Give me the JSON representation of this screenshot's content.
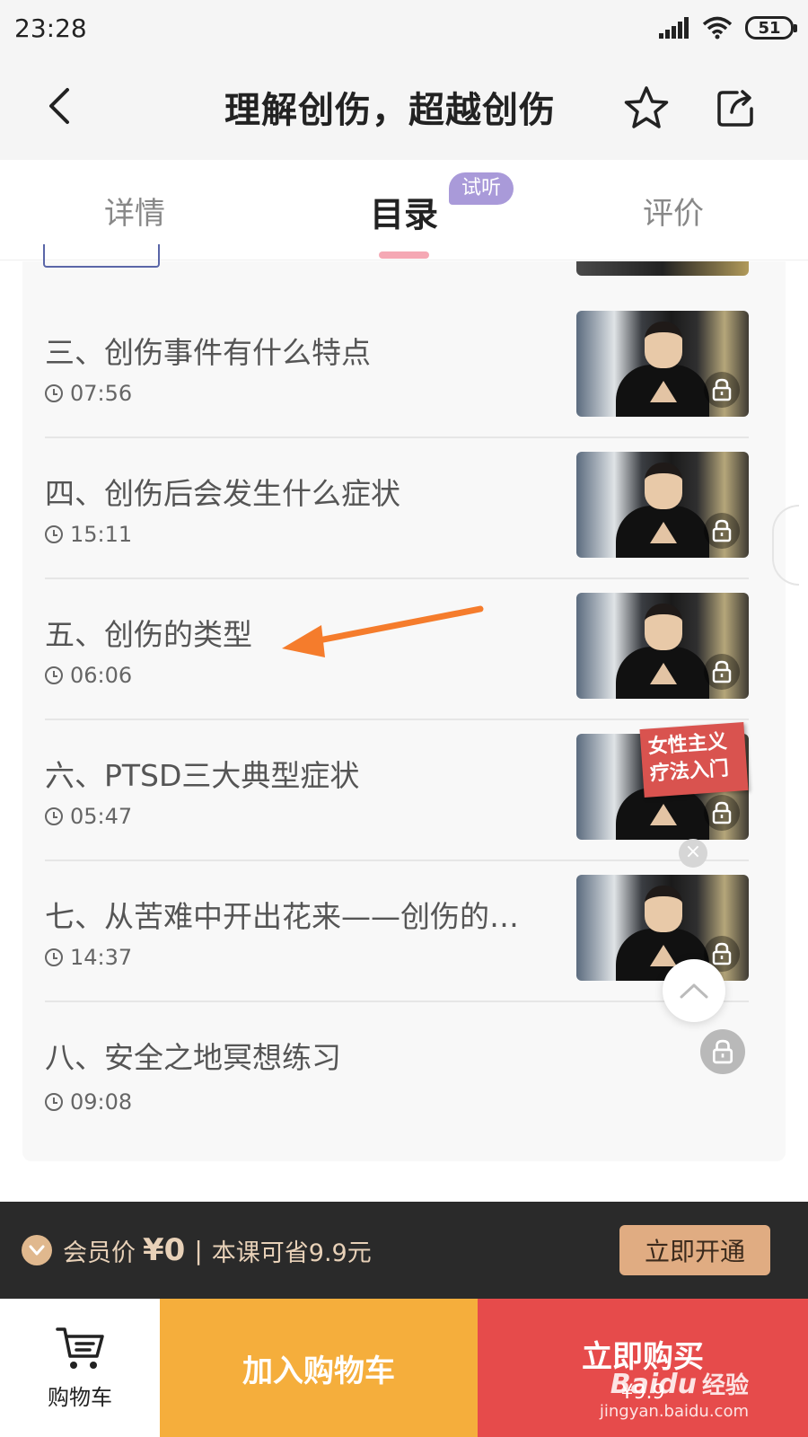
{
  "status_bar": {
    "time": "23:28",
    "battery": "51"
  },
  "nav": {
    "title": "理解创伤，超越创伤"
  },
  "tabs": [
    {
      "label": "详情"
    },
    {
      "label": "目录",
      "badge": "试听",
      "active": true
    },
    {
      "label": "评价"
    }
  ],
  "lessons": [
    {
      "title": "三、创伤事件有什么特点",
      "duration": "07:56",
      "locked": true
    },
    {
      "title": "四、创伤后会发生什么症状",
      "duration": "15:11",
      "locked": true
    },
    {
      "title": "五、创伤的类型",
      "duration": "06:06",
      "locked": true
    },
    {
      "title": "六、PTSD三大典型症状",
      "duration": "05:47",
      "locked": true
    },
    {
      "title": "七、从苦难中开出花来——创伤的意…",
      "duration": "14:37",
      "locked": true
    },
    {
      "title": "八、安全之地冥想练习",
      "duration": "09:08",
      "locked": true
    }
  ],
  "promo_tag": {
    "line1": "女性主义",
    "line2": "疗法入门"
  },
  "member_bar": {
    "label": "会员价",
    "price": "¥0",
    "separator": "|",
    "savings": "本课可省9.9元",
    "open_button": "立即开通"
  },
  "bottom_bar": {
    "cart_label": "购物车",
    "add_cart_button": "加入购物车",
    "buy_button": "立即购买",
    "buy_price": "¥9.9"
  },
  "watermark": {
    "brand": "Baidu",
    "name": "经验",
    "url": "jingyan.baidu.com"
  },
  "colors": {
    "accent_red": "#e64b4b",
    "accent_orange": "#f5ae3c",
    "member_gold": "#e0ac82",
    "tab_badge": "#a99ad9",
    "annotation_arrow": "#f57c2c"
  },
  "icons": [
    "back-icon",
    "star-icon",
    "share-icon",
    "clock-icon",
    "lock-icon",
    "chevron-up-icon",
    "cart-icon",
    "vip-icon"
  ]
}
